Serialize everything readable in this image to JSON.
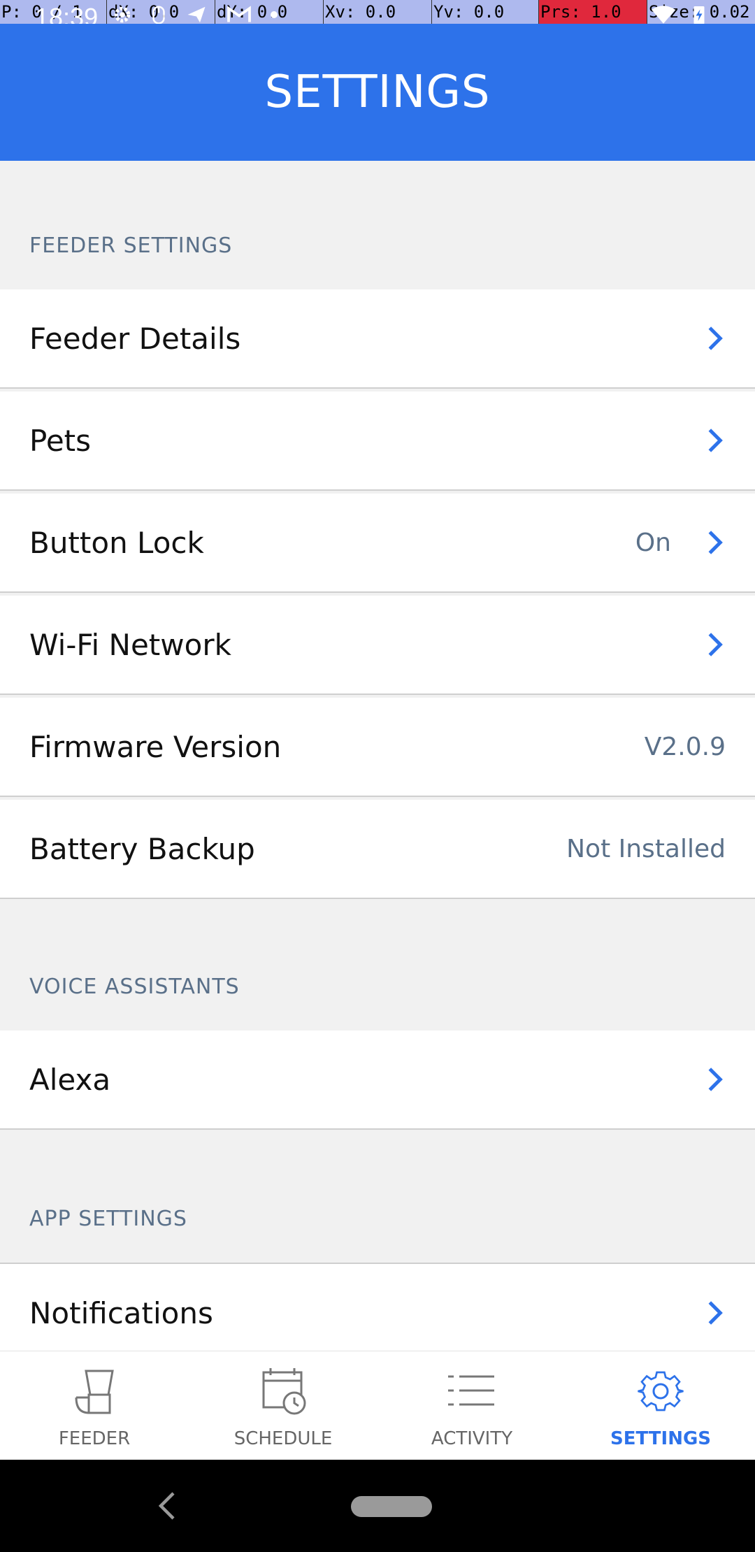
{
  "status_bar": {
    "debug": {
      "p": "P: 0 / 1",
      "dx": "dX: 0.0",
      "dy": "dY: 0.0",
      "xv": "Xv: 0.0",
      "yv": "Yv: 0.0",
      "prs": "Prs: 1.0",
      "size": "Size: 0.02"
    },
    "time": "18:39"
  },
  "header": {
    "title": "SETTINGS"
  },
  "sections": {
    "feeder": {
      "label": "FEEDER SETTINGS",
      "items": [
        {
          "label": "Feeder Details",
          "value": ""
        },
        {
          "label": "Pets",
          "value": ""
        },
        {
          "label": "Button Lock",
          "value": "On"
        },
        {
          "label": "Wi-Fi Network",
          "value": ""
        },
        {
          "label": "Firmware Version",
          "value": "V2.0.9"
        },
        {
          "label": "Battery Backup",
          "value": "Not Installed"
        }
      ]
    },
    "voice": {
      "label": "VOICE ASSISTANTS",
      "items": [
        {
          "label": "Alexa",
          "value": ""
        }
      ]
    },
    "app": {
      "label": "APP SETTINGS",
      "items": [
        {
          "label": "Notifications",
          "value": ""
        }
      ]
    }
  },
  "bottom_nav": {
    "items": [
      {
        "label": "FEEDER",
        "icon": "feeder-icon"
      },
      {
        "label": "SCHEDULE",
        "icon": "schedule-icon"
      },
      {
        "label": "ACTIVITY",
        "icon": "activity-list-icon"
      },
      {
        "label": "SETTINGS",
        "icon": "gear-icon"
      }
    ],
    "active_index": 3
  },
  "colors": {
    "primary": "#2d72ea",
    "section_text": "#5a7089",
    "background": "#f1f1f1"
  }
}
